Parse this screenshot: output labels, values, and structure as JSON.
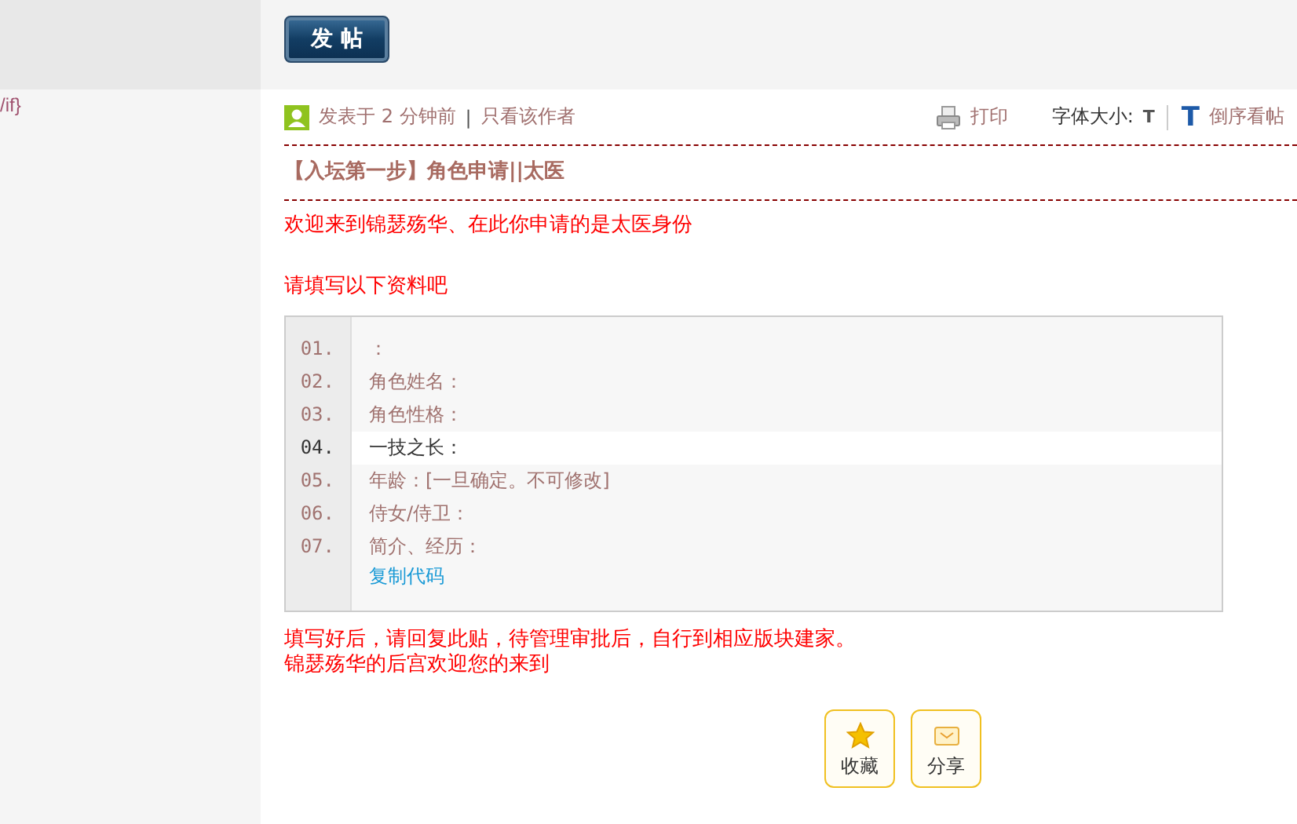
{
  "sidebar": {
    "fragment": "/if}"
  },
  "post_button": "发 帖",
  "meta": {
    "posted": "发表于 2 分钟前",
    "separator": "|",
    "author_only": "只看该作者",
    "print": "打印",
    "font_size_label": "字体大小:",
    "font_small": "T",
    "font_large": "T",
    "reverse": "倒序看帖"
  },
  "title": "【入坛第一步】角色申请||太医",
  "intro": [
    "欢迎来到锦瑟殇华、在此你申请的是太医身份",
    "请填写以下资料吧"
  ],
  "code": {
    "lines": [
      {
        "number": "01.",
        "text": "：",
        "selected": false
      },
      {
        "number": "02.",
        "text": "角色姓名：",
        "selected": false
      },
      {
        "number": "03.",
        "text": "角色性格：",
        "selected": false
      },
      {
        "number": "04.",
        "text": "一技之长：",
        "selected": true
      },
      {
        "number": "05.",
        "text": "年龄：[一旦确定。不可修改]",
        "selected": false
      },
      {
        "number": "06.",
        "text": "侍女/侍卫：",
        "selected": false
      },
      {
        "number": "07.",
        "text": "简介、经历：",
        "selected": false
      }
    ],
    "copy_link": "复制代码"
  },
  "outro": [
    "填写好后，请回复此贴，待管理审批后，自行到相应版块建家。",
    "锦瑟殇华的后宫欢迎您的来到"
  ],
  "actions": [
    {
      "kind": "favorite",
      "label": "收藏"
    },
    {
      "kind": "share",
      "label": "分享"
    }
  ]
}
